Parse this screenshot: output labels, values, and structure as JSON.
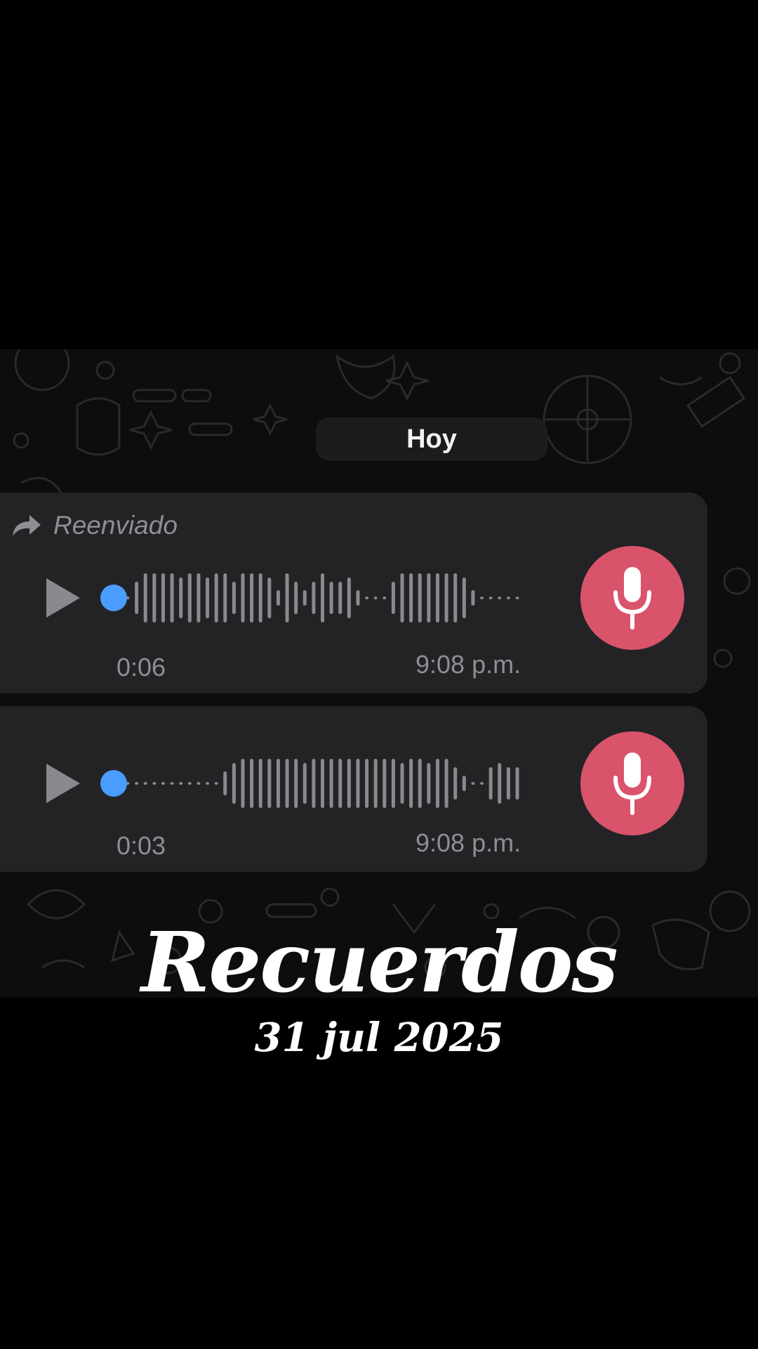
{
  "chat": {
    "date_chip": "Hoy",
    "messages": [
      {
        "forwarded_label": "Reenviado",
        "duration": "0:06",
        "time": "9:08 p.m.",
        "progress": 0,
        "waveform": [
          0,
          3,
          5,
          5,
          5,
          5,
          4,
          5,
          5,
          4,
          5,
          5,
          3,
          5,
          5,
          5,
          4,
          1,
          5,
          3,
          1,
          3,
          5,
          3,
          3,
          4,
          1,
          0,
          0,
          0,
          3,
          5,
          5,
          5,
          5,
          5,
          5,
          5,
          4,
          1,
          0,
          0,
          0,
          0,
          0
        ],
        "avatar_icon": "mic-icon"
      },
      {
        "forwarded_label": "",
        "duration": "0:03",
        "time": "9:08 p.m.",
        "progress": 0,
        "waveform": [
          0,
          0,
          0,
          0,
          0,
          0,
          0,
          0,
          0,
          0,
          0,
          2,
          4,
          5,
          5,
          5,
          5,
          5,
          5,
          5,
          4,
          5,
          5,
          5,
          5,
          5,
          5,
          5,
          5,
          5,
          5,
          4,
          5,
          5,
          4,
          5,
          5,
          3,
          1,
          0,
          0,
          3,
          4,
          3,
          3
        ],
        "avatar_icon": "mic-icon"
      }
    ]
  },
  "caption": {
    "title": "Recuerdos",
    "date": "31 jul 2025"
  },
  "colors": {
    "background": "#000000",
    "chat_bg": "#0d0c0e",
    "bubble": "#232326",
    "progress_dot": "#4a9dff",
    "waveform": "#8a8a8e",
    "avatar": "#d9536b"
  }
}
